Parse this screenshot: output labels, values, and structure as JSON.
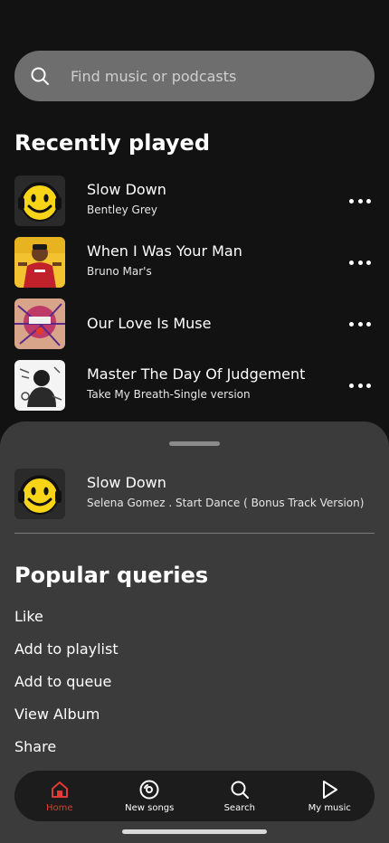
{
  "search": {
    "placeholder": "Find music or podcasts",
    "icon": "search-icon"
  },
  "recently_played": {
    "title": "Recently played",
    "tracks": [
      {
        "title": "Slow Down",
        "artist": "Bentley Grey",
        "art": "smiley-headphones"
      },
      {
        "title": "When I Was Your Man",
        "artist": "Bruno Mar's",
        "art": "artist-photo"
      },
      {
        "title": "Our Love Is Muse",
        "artist": "",
        "art": "muse-cover"
      },
      {
        "title": "Master The Day Of Judgement",
        "artist": "Take My Breath-Single version",
        "art": "bw-cover"
      }
    ]
  },
  "sheet": {
    "track": {
      "title": "Slow Down",
      "subtitle": "Selena Gomez . Start Dance ( Bonus Track Version)"
    },
    "title": "Popular queries",
    "queries": [
      "Like",
      "Add to playlist",
      "Add to queue",
      "View Album",
      "Share"
    ]
  },
  "nav": {
    "items": [
      {
        "label": "Home",
        "icon": "home-icon",
        "active": true
      },
      {
        "label": "New songs",
        "icon": "disc-icon",
        "active": false
      },
      {
        "label": "Search",
        "icon": "search-icon",
        "active": false
      },
      {
        "label": "My music",
        "icon": "play-icon",
        "active": false
      }
    ]
  },
  "colors": {
    "background": "#121212",
    "sheet": "#3b3b3b",
    "accent": "#e53935",
    "search_bar": "#6e6e6e"
  }
}
